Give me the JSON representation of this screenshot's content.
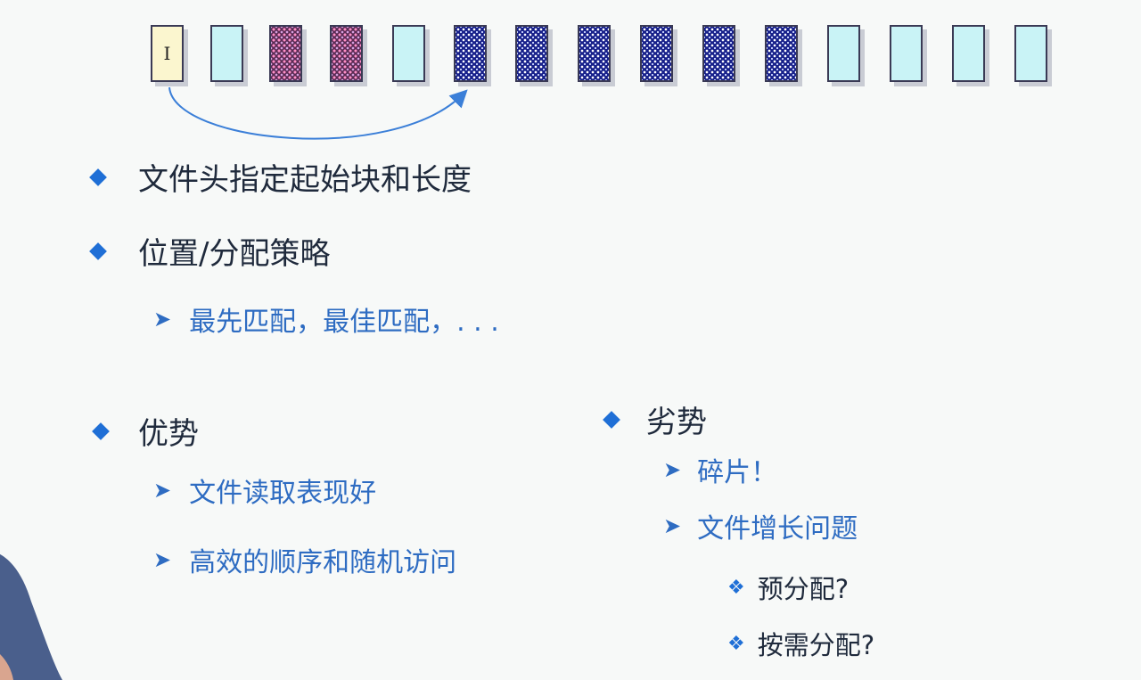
{
  "blocks": {
    "header_label": "I",
    "sequence": [
      "header",
      "free",
      "other",
      "other",
      "free",
      "file",
      "file",
      "file",
      "file",
      "file",
      "file",
      "free",
      "free",
      "free",
      "free"
    ]
  },
  "colors": {
    "bullet": "#1f6fd6",
    "sub_text": "#2e6cc2",
    "main_text": "#1f2a3c",
    "file_block": "#17208a",
    "free_block": "#c9f3f6",
    "other_block": "#5a2a52",
    "header_block": "#fbf6cf"
  },
  "bullets": {
    "header_spec": "文件头指定起始块和长度",
    "placement": "位置/分配策略",
    "placement_sub": "最先匹配，最佳匹配，. . .",
    "advantages": "优势",
    "adv_1": "文件读取表现好",
    "adv_2": "高效的顺序和随机访问",
    "disadvantages": "劣势",
    "dis_1": "碎片！",
    "dis_2": "文件增长问题",
    "dis_2_a": "预分配?",
    "dis_2_b": "按需分配?"
  },
  "icons": {
    "level1": "diamond-bullet-icon",
    "level2": "chevron-arrow-icon",
    "level3": "clover-bullet-icon"
  }
}
